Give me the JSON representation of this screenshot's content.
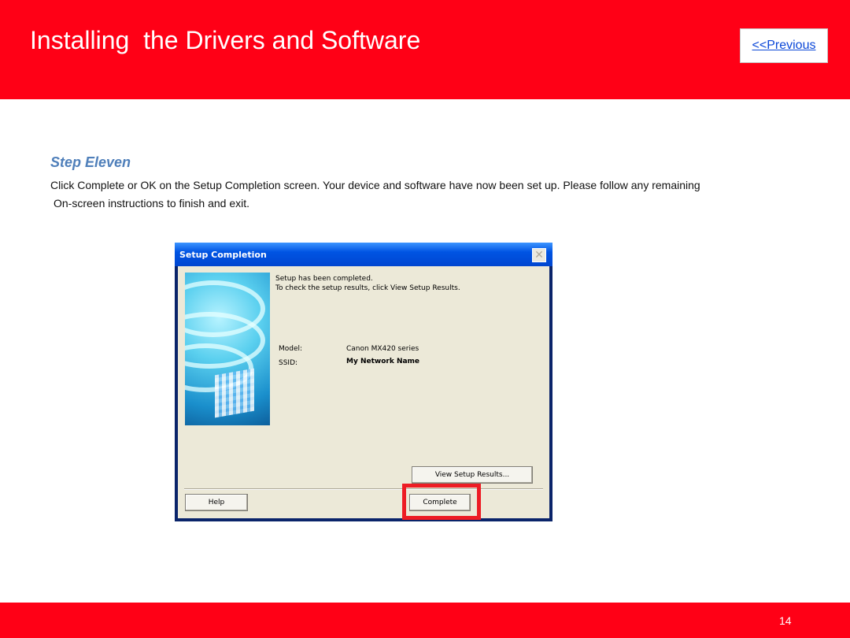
{
  "header": {
    "title": "Installing  the Drivers and Software",
    "previous_label": "<<Previous"
  },
  "content": {
    "step_title": "Step Eleven",
    "description_line1": "Click Complete or OK on the Setup Completion screen. Your device and software have now been set up. Please follow any remaining",
    "description_line2": "On-screen instructions to finish and exit."
  },
  "dialog": {
    "title": "Setup Completion",
    "message_line1": "Setup has been completed.",
    "message_line2": "To check the setup results, click View Setup Results.",
    "model_label": "Model:",
    "model_value": "Canon MX420 series",
    "ssid_label": "SSID:",
    "ssid_value": "My Network Name",
    "view_results_label": "View Setup Results...",
    "help_label": "Help",
    "complete_label": "Complete"
  },
  "footer": {
    "page_number": "14"
  },
  "colors": {
    "brand_red": "#ff0016",
    "link_blue": "#0b47d8",
    "step_blue": "#4f7fba",
    "highlight_red": "#ed1c24"
  }
}
